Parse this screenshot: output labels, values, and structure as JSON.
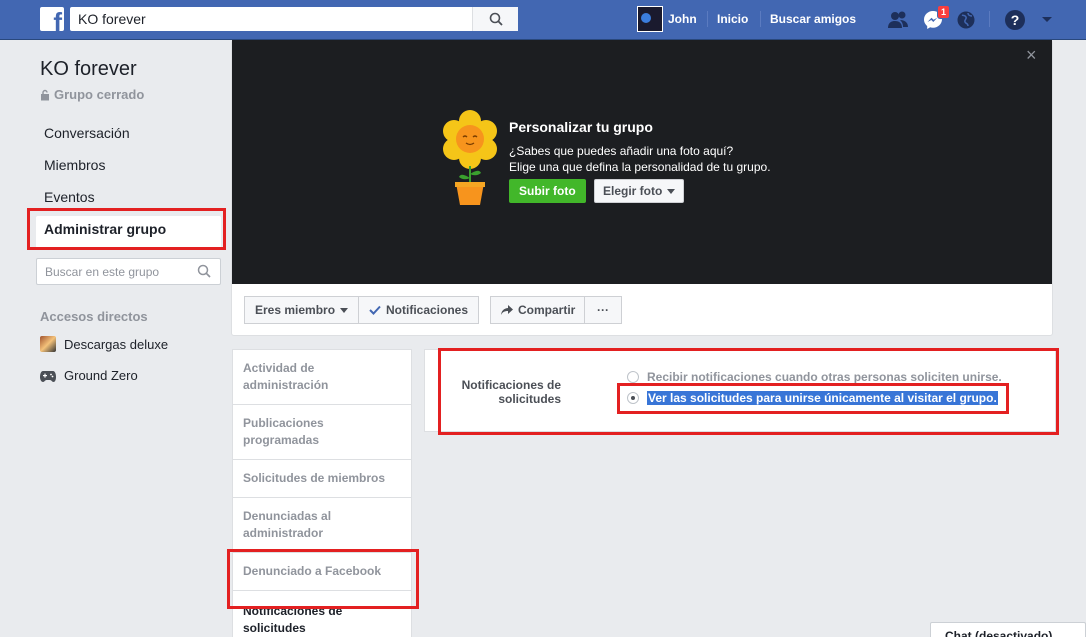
{
  "topbar": {
    "search_value": "KO forever",
    "profile_name": "John",
    "home_label": "Inicio",
    "find_friends_label": "Buscar amigos",
    "messages_badge": "1",
    "logo_letter": "f"
  },
  "group": {
    "name": "KO forever",
    "privacy": "Grupo cerrado"
  },
  "left_nav": {
    "items": [
      {
        "label": "Conversación"
      },
      {
        "label": "Miembros"
      },
      {
        "label": "Eventos"
      },
      {
        "label": "Administrar grupo"
      }
    ],
    "search_placeholder": "Buscar en este grupo",
    "shortcuts_title": "Accesos directos",
    "shortcuts": [
      {
        "label": "Descargas deluxe"
      },
      {
        "label": "Ground Zero"
      }
    ]
  },
  "cover": {
    "heading": "Personalizar tu grupo",
    "line1": "¿Sabes que puedes añadir una foto aquí?",
    "line2": "Elige una que defina la personalidad de tu grupo.",
    "upload_label": "Subir foto",
    "choose_label": "Elegir foto",
    "close_glyph": "×"
  },
  "actions": {
    "member_label": "Eres miembro",
    "notifications_label": "Notificaciones",
    "share_label": "Compartir",
    "more_label": "···"
  },
  "admin_nav": {
    "items": [
      {
        "label": "Actividad de administración"
      },
      {
        "label": "Publicaciones programadas"
      },
      {
        "label": "Solicitudes de miembros"
      },
      {
        "label": "Denunciadas al administrador"
      },
      {
        "label": "Denunciado a Facebook"
      },
      {
        "label": "Notificaciones de solicitudes"
      }
    ]
  },
  "settings": {
    "label": "Notificaciones de solicitudes",
    "option1": "Recibir notificaciones cuando otras personas soliciten unirse.",
    "option2": "Ver las solicitudes para unirse únicamente al visitar el grupo.",
    "selected_option": 2
  },
  "chat": {
    "label": "Chat (desactivado)"
  },
  "colors": {
    "brand": "#4267b2",
    "highlight_box": "#e32021",
    "upload_green": "#42b72a",
    "selection": "#3875d7"
  }
}
